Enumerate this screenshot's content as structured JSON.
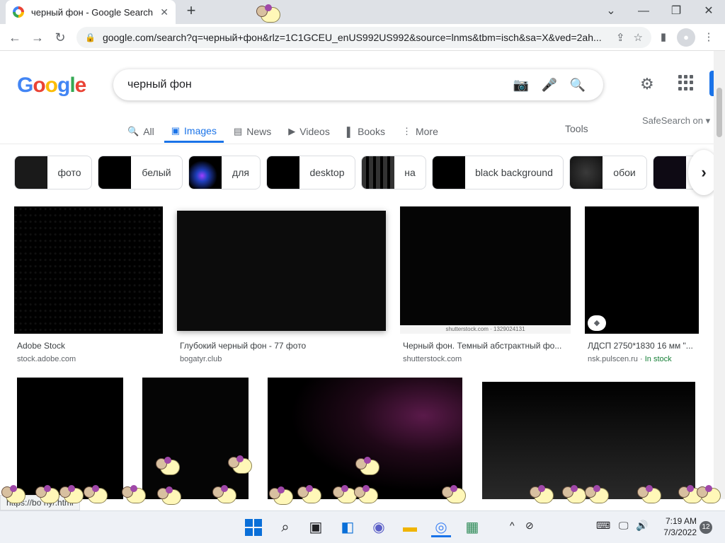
{
  "browser": {
    "tab_title": "черный фон - Google Search",
    "tab_close": "✕",
    "new_tab": "+",
    "minimize": "⌄",
    "restore_down": "—",
    "maximize": "❐",
    "close": "✕",
    "back": "←",
    "forward": "→",
    "reload": "↻",
    "url": "google.com/search?q=черный+фон&rlz=1C1GCEU_enUS992US992&source=lnms&tbm=isch&sa=X&ved=2ah...",
    "share_icon": "⇪",
    "bookmark_icon": "☆",
    "side_panel_icon": "▮",
    "profile_icon": "●",
    "menu_icon": "⋮"
  },
  "google": {
    "logo": [
      "G",
      "o",
      "o",
      "g",
      "l",
      "e"
    ],
    "logo_colors": [
      "#4285f4",
      "#ea4335",
      "#fbbc05",
      "#4285f4",
      "#34a853",
      "#ea4335"
    ],
    "query": "черный фон",
    "camera_icon": "📷",
    "mic_icon": "🎤",
    "search_icon": "🔍",
    "settings_icon": "⚙",
    "nav": {
      "all": "All",
      "images": "Images",
      "news": "News",
      "videos": "Videos",
      "books": "Books",
      "more": "More",
      "tools": "Tools",
      "safesearch": "SafeSearch on ▾"
    },
    "nav_icons": {
      "all": "🔍",
      "images": "▣",
      "news": "▤",
      "videos": "▶",
      "books": "▌",
      "more": "⋮"
    },
    "chips": [
      {
        "label": "фото",
        "thumb": "#1a1a1a"
      },
      {
        "label": "белый",
        "thumb": "#000000"
      },
      {
        "label": "для",
        "thumb": "#2a1a5a"
      },
      {
        "label": "desktop",
        "thumb": "#000000"
      },
      {
        "label": "на",
        "thumb": "#222222"
      },
      {
        "label": "black background",
        "thumb": "#000000"
      },
      {
        "label": "обои",
        "thumb": "#1c1c1c"
      },
      {
        "label": "",
        "thumb": "#0e0a14"
      }
    ],
    "chip_next": "›",
    "results": [
      {
        "title": "Adobe Stock",
        "source": "stock.adobe.com"
      },
      {
        "title": "Глубокий черный фон - 77 фото",
        "source": "bogatyr.club"
      },
      {
        "title": "Черный фон. Темный абстрактный фо...",
        "source": "shutterstock.com",
        "watermark": "shutterstock.com · 1329024131"
      },
      {
        "title": "ЛДСП 2750*1830 16 мм \"...",
        "source": "nsk.pulscen.ru",
        "stock": "In stock",
        "badge": "◆"
      }
    ]
  },
  "status_url": "https://bo                                        ny/.html",
  "taskbar": {
    "search_icon": "⌕",
    "taskview_icon": "▣",
    "widgets_icon": "◧",
    "chat_icon": "◉",
    "explorer_icon": "▬",
    "chrome_icon": "◎",
    "app_icon": "▦",
    "tray_up": "^",
    "tray_icons": [
      "⊘",
      "⌨",
      "🖵",
      "🔊"
    ],
    "time": "7:19 AM",
    "date": "7/3/2022",
    "notifications": "12"
  }
}
